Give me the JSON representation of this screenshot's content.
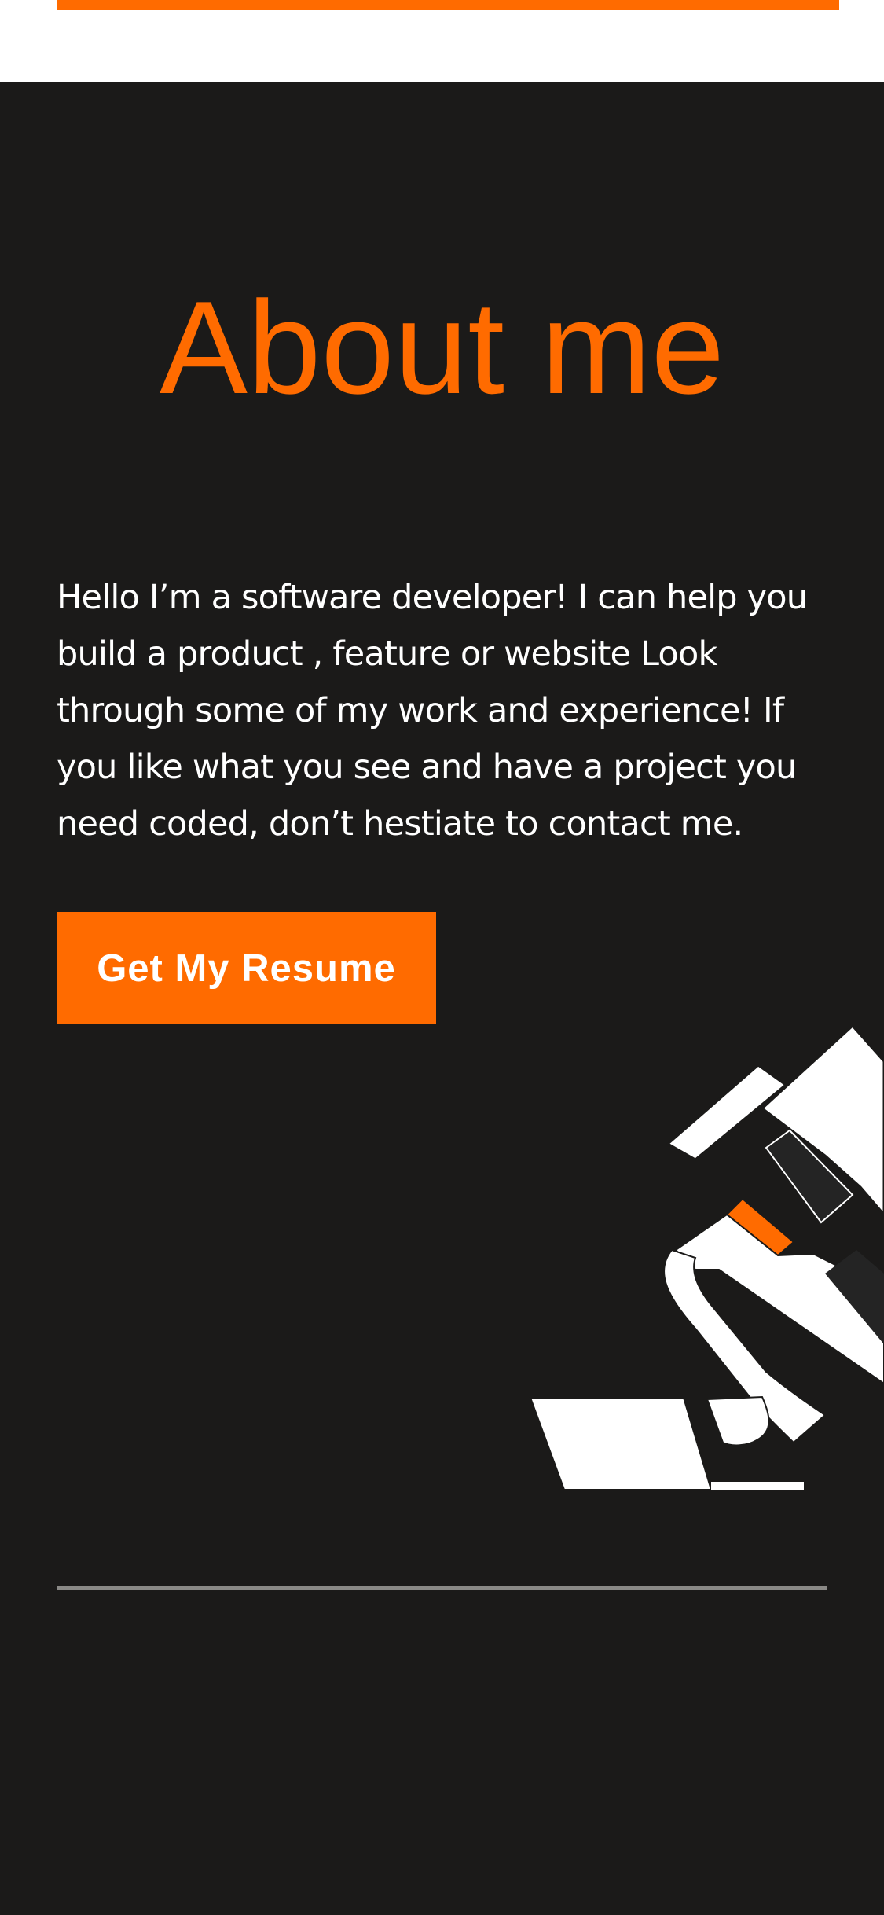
{
  "about": {
    "title": "About me",
    "description": "Hello I’m a software developer! I can help you build a product , feature or website Look through some of my work and experience! If you like what you see and have a project you need coded, don’t hestiate to contact me.",
    "resume_button_label": "Get My Resume"
  },
  "colors": {
    "accent": "#ff6b00",
    "background": "#1b1a19",
    "text": "#ffffff",
    "divider": "#8a8986"
  },
  "illustration": {
    "name": "abstract-figure-illustration"
  }
}
